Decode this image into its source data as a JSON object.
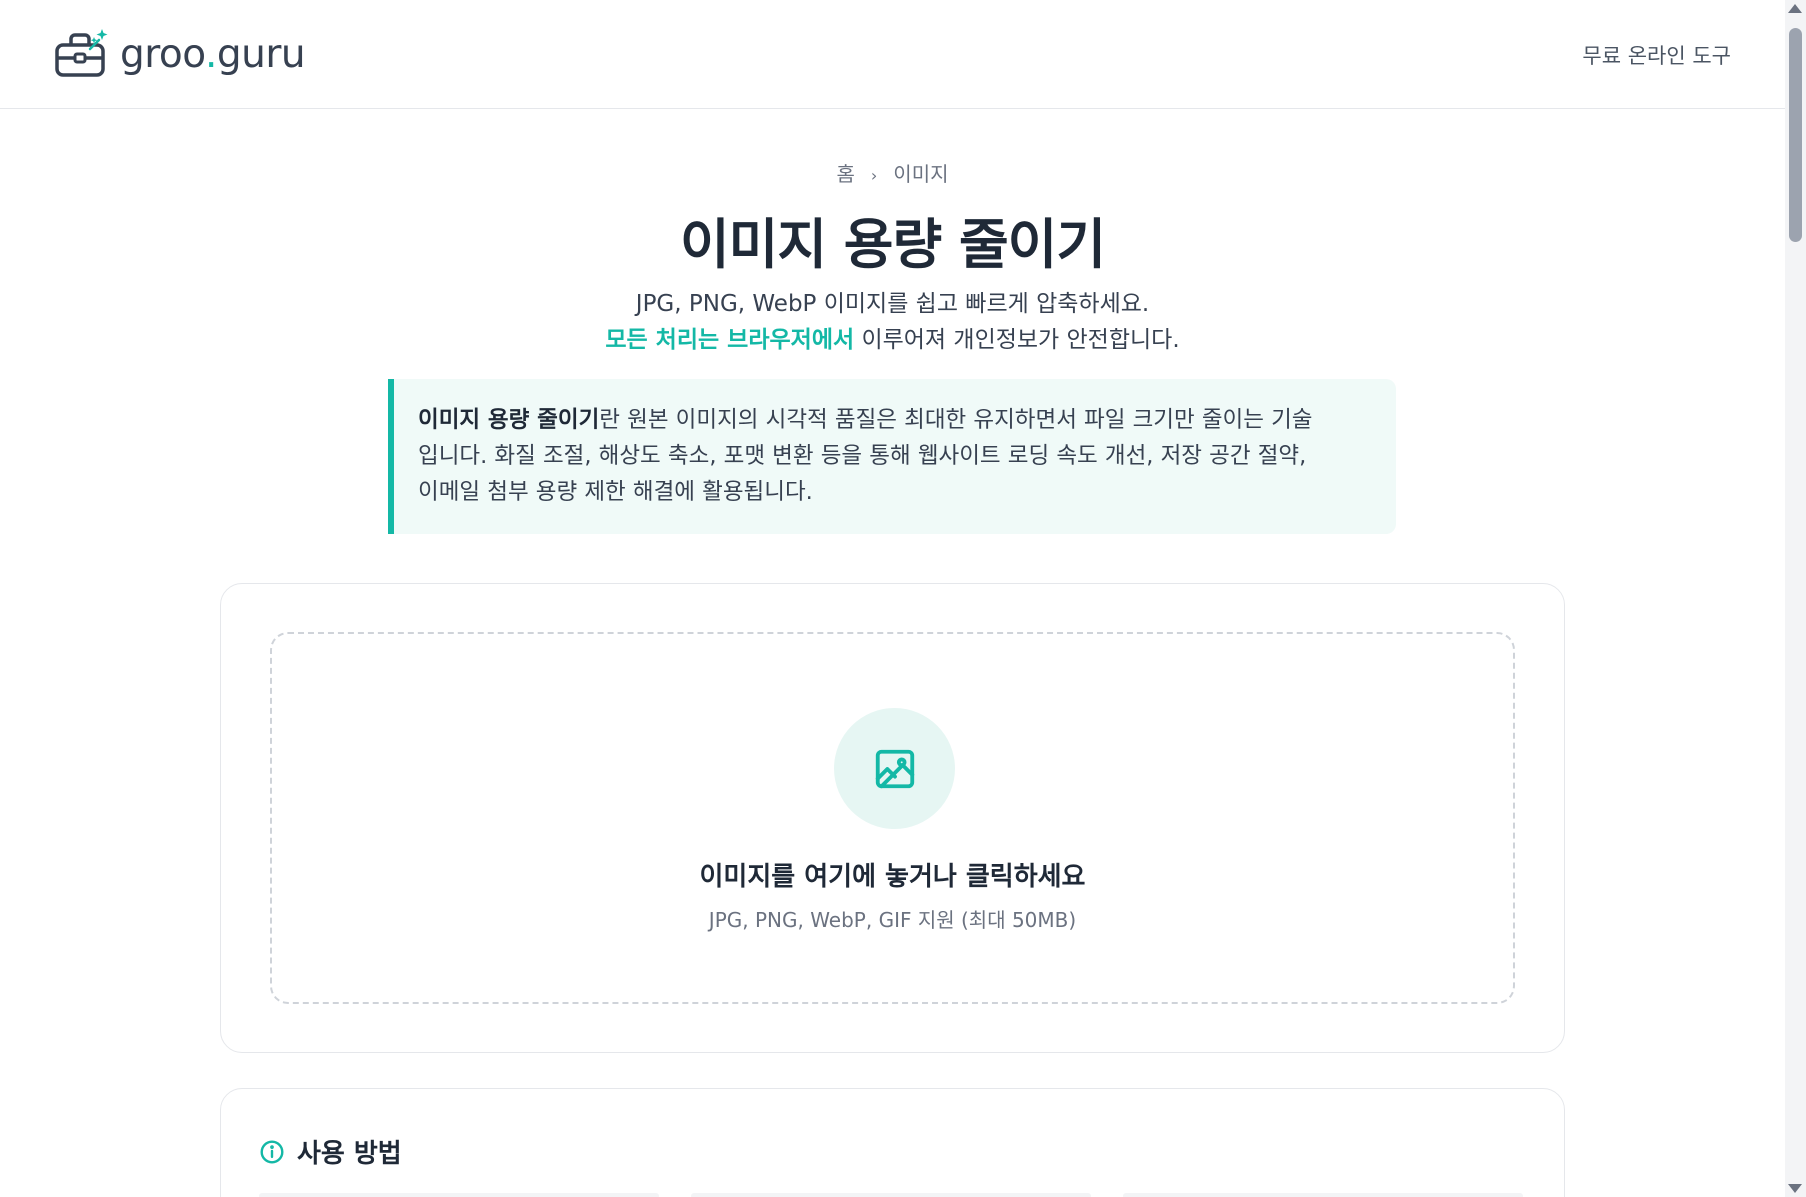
{
  "header": {
    "logo_text_main": "groo",
    "logo_text_dot": ".",
    "logo_text_tail": "guru",
    "nav_label": "무료 온라인 도구"
  },
  "breadcrumb": {
    "home": "홈",
    "separator": "›",
    "current": "이미지"
  },
  "page": {
    "title": "이미지 용량 줄이기",
    "subtitle_line1": "JPG, PNG, WebP 이미지를 쉽고 빠르게 압축하세요.",
    "subtitle_highlight": "모든 처리는 브라우저에서",
    "subtitle_line2_rest": " 이루어져 개인정보가 안전합니다."
  },
  "info": {
    "bold_term": "이미지 용량 줄이기",
    "line1_rest": "란 원본 이미지의 시각적 품질은 최대한 유지하면서 파일 크기만 줄이는 기술",
    "line2": "입니다. 화질 조절, 해상도 축소, 포맷 변환 등을 통해 웹사이트 로딩 속도 개선, 저장 공간 절약,",
    "line3": "이메일 첨부 용량 제한 해결에 활용됩니다."
  },
  "dropzone": {
    "icon": "image-icon",
    "title": "이미지를 여기에 놓거나 클릭하세요",
    "subtitle": "JPG, PNG, WebP, GIF 지원 (최대 50MB)"
  },
  "howto": {
    "icon": "info-icon",
    "title": "사용 방법"
  },
  "colors": {
    "accent": "#14b8a6",
    "info_bg": "#f0faf8",
    "icon_circle_bg": "#e6f6f3",
    "text_dark": "#1f2937",
    "text_muted": "#6b7280"
  }
}
